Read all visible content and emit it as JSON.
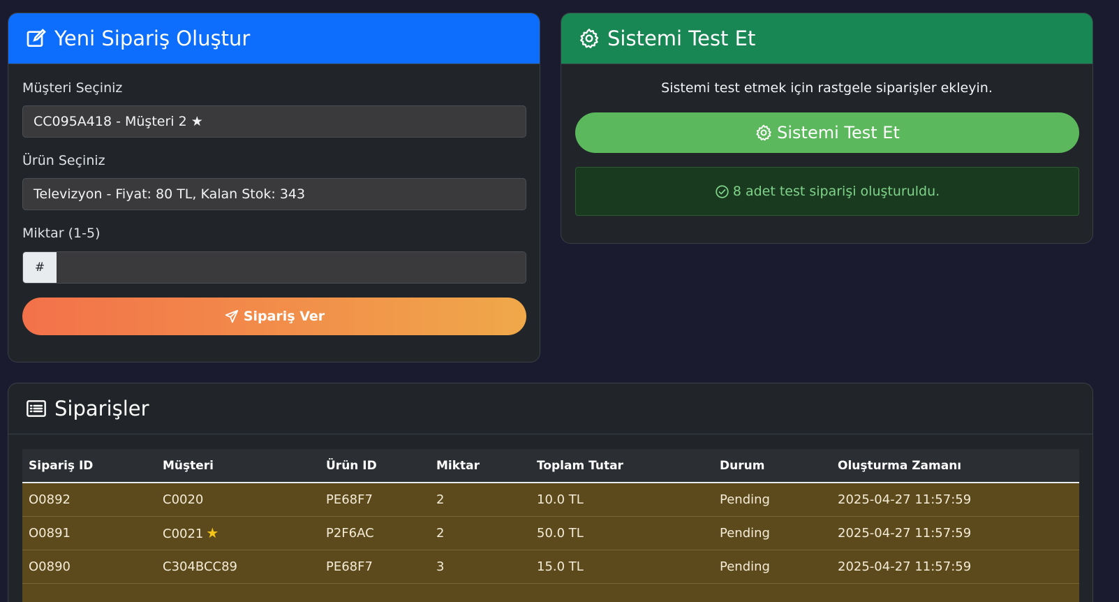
{
  "order_form": {
    "title": "Yeni Sipariş Oluştur",
    "customer_label": "Müşteri Seçiniz",
    "customer_value": "CC095A418 - Müşteri 2 ★",
    "product_label": "Ürün Seçiniz",
    "product_value": "Televizyon - Fiyat: 80 TL, Kalan Stok: 343",
    "quantity_label": "Miktar (1-5)",
    "quantity_addon": "#",
    "quantity_value": "",
    "submit_label": "Sipariş Ver",
    "header_color": "#0d6efd"
  },
  "test_panel": {
    "title": "Sistemi Test Et",
    "description": "Sistemi test etmek için rastgele siparişler ekleyin.",
    "button_label": "Sistemi Test Et",
    "alert_text": "8 adet test siparişi oluşturuldu.",
    "header_color": "#198754"
  },
  "orders": {
    "title": "Siparişler",
    "columns": [
      "Sipariş ID",
      "Müşteri",
      "Ürün ID",
      "Miktar",
      "Toplam Tutar",
      "Durum",
      "Oluşturma Zamanı"
    ],
    "rows": [
      {
        "id": "O0892",
        "customer": "C0020",
        "premium": false,
        "product": "PE68F7",
        "qty": "2",
        "total": "10.0 TL",
        "status": "Pending",
        "created": "2025-04-27 11:57:59"
      },
      {
        "id": "O0891",
        "customer": "C0021",
        "premium": true,
        "product": "P2F6AC",
        "qty": "2",
        "total": "50.0 TL",
        "status": "Pending",
        "created": "2025-04-27 11:57:59"
      },
      {
        "id": "O0890",
        "customer": "C304BCC89",
        "premium": false,
        "product": "PE68F7",
        "qty": "3",
        "total": "15.0 TL",
        "status": "Pending",
        "created": "2025-04-27 11:57:59"
      },
      {
        "id": "",
        "customer": "",
        "premium": false,
        "product": "",
        "qty": "",
        "total": "",
        "status": "",
        "created": ""
      }
    ]
  },
  "icons": {
    "order_title": "edit-icon",
    "test_title": "gear-icon",
    "submit": "send-icon",
    "alert": "check-circle-icon",
    "orders_title": "list-icon",
    "premium": "star-icon"
  }
}
